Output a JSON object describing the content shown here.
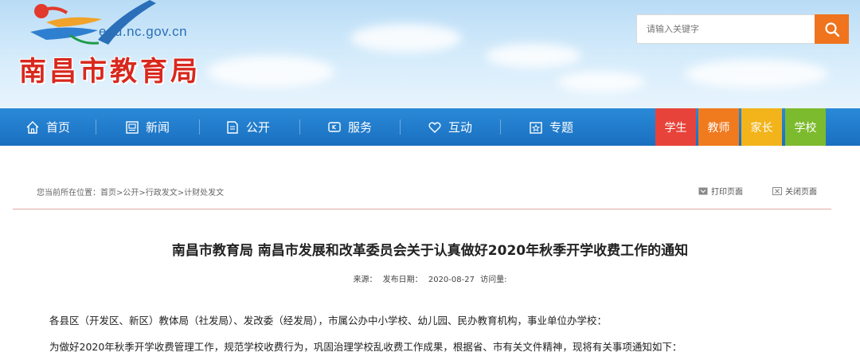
{
  "site": {
    "url": "edu.nc.gov.cn",
    "name": "南昌市教育局"
  },
  "search": {
    "placeholder": "请输入关键字"
  },
  "nav": {
    "items": [
      {
        "label": "首页",
        "icon": "home-icon"
      },
      {
        "label": "新闻",
        "icon": "news-icon"
      },
      {
        "label": "公开",
        "icon": "document-icon"
      },
      {
        "label": "服务",
        "icon": "service-icon"
      },
      {
        "label": "互动",
        "icon": "heart-icon"
      },
      {
        "label": "专题",
        "icon": "topic-icon"
      }
    ],
    "roles": [
      {
        "label": "学生",
        "color": "#e8433a"
      },
      {
        "label": "教师",
        "color": "#f07a1e"
      },
      {
        "label": "家长",
        "color": "#f2b41a"
      },
      {
        "label": "学校",
        "color": "#7dbb2e"
      }
    ]
  },
  "breadcrumb": {
    "prefix": "您当前所在位置：",
    "items": [
      "首页",
      "公开",
      "行政发文",
      "计财处发文"
    ],
    "separator": ">"
  },
  "actions": {
    "print": "打印页面",
    "close": "关闭页面"
  },
  "article": {
    "title": "南昌市教育局 南昌市发展和改革委员会关于认真做好2020年秋季开学收费工作的通知",
    "source_label": "来源：",
    "date_label": "发布日期：",
    "date": "2020-08-27",
    "views_label": "访问量:",
    "paragraphs": [
      "各县区（开发区、新区）教体局（社发局）、发改委（经发局），市属公办中小学校、幼儿园、民办教育机构，事业单位办学校：",
      "为做好2020年秋季开学收费管理工作，规范学校收费行为，巩固治理学校乱收费工作成果，根据省、市有关文件精神，现将有关事项通知如下："
    ]
  }
}
